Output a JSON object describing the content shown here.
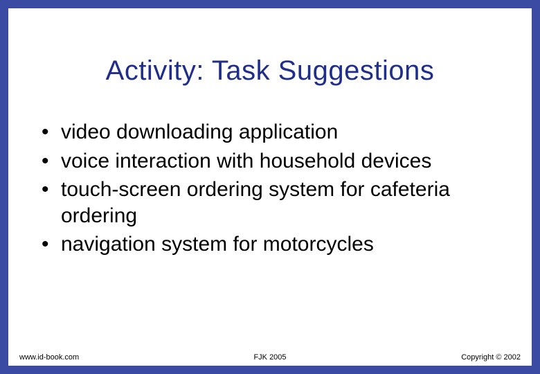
{
  "title": "Activity: Task Suggestions",
  "bullets": [
    "video downloading application",
    "voice interaction with household devices",
    "touch-screen ordering system for cafeteria ordering",
    "navigation system for motorcycles"
  ],
  "footer": {
    "left": "www.id-book.com",
    "center": "FJK 2005",
    "right": "Copyright © 2002"
  }
}
